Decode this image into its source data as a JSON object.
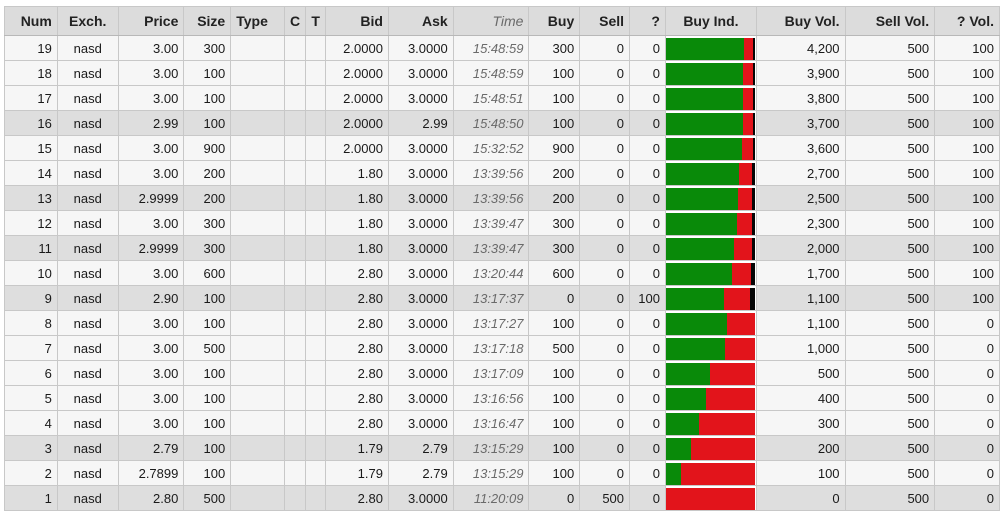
{
  "headers": {
    "num": "Num",
    "exch": "Exch.",
    "price": "Price",
    "size": "Size",
    "type": "Type",
    "c": "C",
    "t": "T",
    "bid": "Bid",
    "ask": "Ask",
    "time": "Time",
    "buy": "Buy",
    "sell": "Sell",
    "q": "?",
    "buy_ind": "Buy Ind.",
    "buy_vol": "Buy Vol.",
    "sell_vol": "Sell Vol.",
    "q_vol": "? Vol."
  },
  "colors": {
    "buy": "#098a09",
    "sell": "#e2141b",
    "unknown": "#060606",
    "header_bg": "#dcdcdc",
    "row_light": "#f6f6f6",
    "row_dark": "#dedede"
  },
  "rows": [
    {
      "num": "19",
      "exch": "nasd",
      "price": "3.00",
      "size": "300",
      "type": "",
      "c": "",
      "t": "",
      "bid": "2.0000",
      "ask": "3.0000",
      "time": "15:48:59",
      "buy": "300",
      "sell": "0",
      "q": "0",
      "buy_vol": "4,200",
      "sell_vol": "500",
      "q_vol": "100"
    },
    {
      "num": "18",
      "exch": "nasd",
      "price": "3.00",
      "size": "100",
      "type": "",
      "c": "",
      "t": "",
      "bid": "2.0000",
      "ask": "3.0000",
      "time": "15:48:59",
      "buy": "100",
      "sell": "0",
      "q": "0",
      "buy_vol": "3,900",
      "sell_vol": "500",
      "q_vol": "100"
    },
    {
      "num": "17",
      "exch": "nasd",
      "price": "3.00",
      "size": "100",
      "type": "",
      "c": "",
      "t": "",
      "bid": "2.0000",
      "ask": "3.0000",
      "time": "15:48:51",
      "buy": "100",
      "sell": "0",
      "q": "0",
      "buy_vol": "3,800",
      "sell_vol": "500",
      "q_vol": "100"
    },
    {
      "num": "16",
      "exch": "nasd",
      "price": "2.99",
      "size": "100",
      "type": "",
      "c": "",
      "t": "",
      "bid": "2.0000",
      "ask": "2.99",
      "time": "15:48:50",
      "buy": "100",
      "sell": "0",
      "q": "0",
      "buy_vol": "3,700",
      "sell_vol": "500",
      "q_vol": "100"
    },
    {
      "num": "15",
      "exch": "nasd",
      "price": "3.00",
      "size": "900",
      "type": "",
      "c": "",
      "t": "",
      "bid": "2.0000",
      "ask": "3.0000",
      "time": "15:32:52",
      "buy": "900",
      "sell": "0",
      "q": "0",
      "buy_vol": "3,600",
      "sell_vol": "500",
      "q_vol": "100"
    },
    {
      "num": "14",
      "exch": "nasd",
      "price": "3.00",
      "size": "200",
      "type": "",
      "c": "",
      "t": "",
      "bid": "1.80",
      "ask": "3.0000",
      "time": "13:39:56",
      "buy": "200",
      "sell": "0",
      "q": "0",
      "buy_vol": "2,700",
      "sell_vol": "500",
      "q_vol": "100"
    },
    {
      "num": "13",
      "exch": "nasd",
      "price": "2.9999",
      "size": "200",
      "type": "",
      "c": "",
      "t": "",
      "bid": "1.80",
      "ask": "3.0000",
      "time": "13:39:56",
      "buy": "200",
      "sell": "0",
      "q": "0",
      "buy_vol": "2,500",
      "sell_vol": "500",
      "q_vol": "100"
    },
    {
      "num": "12",
      "exch": "nasd",
      "price": "3.00",
      "size": "300",
      "type": "",
      "c": "",
      "t": "",
      "bid": "1.80",
      "ask": "3.0000",
      "time": "13:39:47",
      "buy": "300",
      "sell": "0",
      "q": "0",
      "buy_vol": "2,300",
      "sell_vol": "500",
      "q_vol": "100"
    },
    {
      "num": "11",
      "exch": "nasd",
      "price": "2.9999",
      "size": "300",
      "type": "",
      "c": "",
      "t": "",
      "bid": "1.80",
      "ask": "3.0000",
      "time": "13:39:47",
      "buy": "300",
      "sell": "0",
      "q": "0",
      "buy_vol": "2,000",
      "sell_vol": "500",
      "q_vol": "100"
    },
    {
      "num": "10",
      "exch": "nasd",
      "price": "3.00",
      "size": "600",
      "type": "",
      "c": "",
      "t": "",
      "bid": "2.80",
      "ask": "3.0000",
      "time": "13:20:44",
      "buy": "600",
      "sell": "0",
      "q": "0",
      "buy_vol": "1,700",
      "sell_vol": "500",
      "q_vol": "100"
    },
    {
      "num": "9",
      "exch": "nasd",
      "price": "2.90",
      "size": "100",
      "type": "",
      "c": "",
      "t": "",
      "bid": "2.80",
      "ask": "3.0000",
      "time": "13:17:37",
      "buy": "0",
      "sell": "0",
      "q": "100",
      "buy_vol": "1,100",
      "sell_vol": "500",
      "q_vol": "100"
    },
    {
      "num": "8",
      "exch": "nasd",
      "price": "3.00",
      "size": "100",
      "type": "",
      "c": "",
      "t": "",
      "bid": "2.80",
      "ask": "3.0000",
      "time": "13:17:27",
      "buy": "100",
      "sell": "0",
      "q": "0",
      "buy_vol": "1,100",
      "sell_vol": "500",
      "q_vol": "0"
    },
    {
      "num": "7",
      "exch": "nasd",
      "price": "3.00",
      "size": "500",
      "type": "",
      "c": "",
      "t": "",
      "bid": "2.80",
      "ask": "3.0000",
      "time": "13:17:18",
      "buy": "500",
      "sell": "0",
      "q": "0",
      "buy_vol": "1,000",
      "sell_vol": "500",
      "q_vol": "0"
    },
    {
      "num": "6",
      "exch": "nasd",
      "price": "3.00",
      "size": "100",
      "type": "",
      "c": "",
      "t": "",
      "bid": "2.80",
      "ask": "3.0000",
      "time": "13:17:09",
      "buy": "100",
      "sell": "0",
      "q": "0",
      "buy_vol": "500",
      "sell_vol": "500",
      "q_vol": "0"
    },
    {
      "num": "5",
      "exch": "nasd",
      "price": "3.00",
      "size": "100",
      "type": "",
      "c": "",
      "t": "",
      "bid": "2.80",
      "ask": "3.0000",
      "time": "13:16:56",
      "buy": "100",
      "sell": "0",
      "q": "0",
      "buy_vol": "400",
      "sell_vol": "500",
      "q_vol": "0"
    },
    {
      "num": "4",
      "exch": "nasd",
      "price": "3.00",
      "size": "100",
      "type": "",
      "c": "",
      "t": "",
      "bid": "2.80",
      "ask": "3.0000",
      "time": "13:16:47",
      "buy": "100",
      "sell": "0",
      "q": "0",
      "buy_vol": "300",
      "sell_vol": "500",
      "q_vol": "0"
    },
    {
      "num": "3",
      "exch": "nasd",
      "price": "2.79",
      "size": "100",
      "type": "",
      "c": "",
      "t": "",
      "bid": "1.79",
      "ask": "2.79",
      "time": "13:15:29",
      "buy": "100",
      "sell": "0",
      "q": "0",
      "buy_vol": "200",
      "sell_vol": "500",
      "q_vol": "0"
    },
    {
      "num": "2",
      "exch": "nasd",
      "price": "2.7899",
      "size": "100",
      "type": "",
      "c": "",
      "t": "",
      "bid": "1.79",
      "ask": "2.79",
      "time": "13:15:29",
      "buy": "100",
      "sell": "0",
      "q": "0",
      "buy_vol": "100",
      "sell_vol": "500",
      "q_vol": "0"
    },
    {
      "num": "1",
      "exch": "nasd",
      "price": "2.80",
      "size": "500",
      "type": "",
      "c": "",
      "t": "",
      "bid": "2.80",
      "ask": "3.0000",
      "time": "11:20:09",
      "buy": "0",
      "sell": "500",
      "q": "0",
      "buy_vol": "0",
      "sell_vol": "500",
      "q_vol": "0"
    }
  ]
}
